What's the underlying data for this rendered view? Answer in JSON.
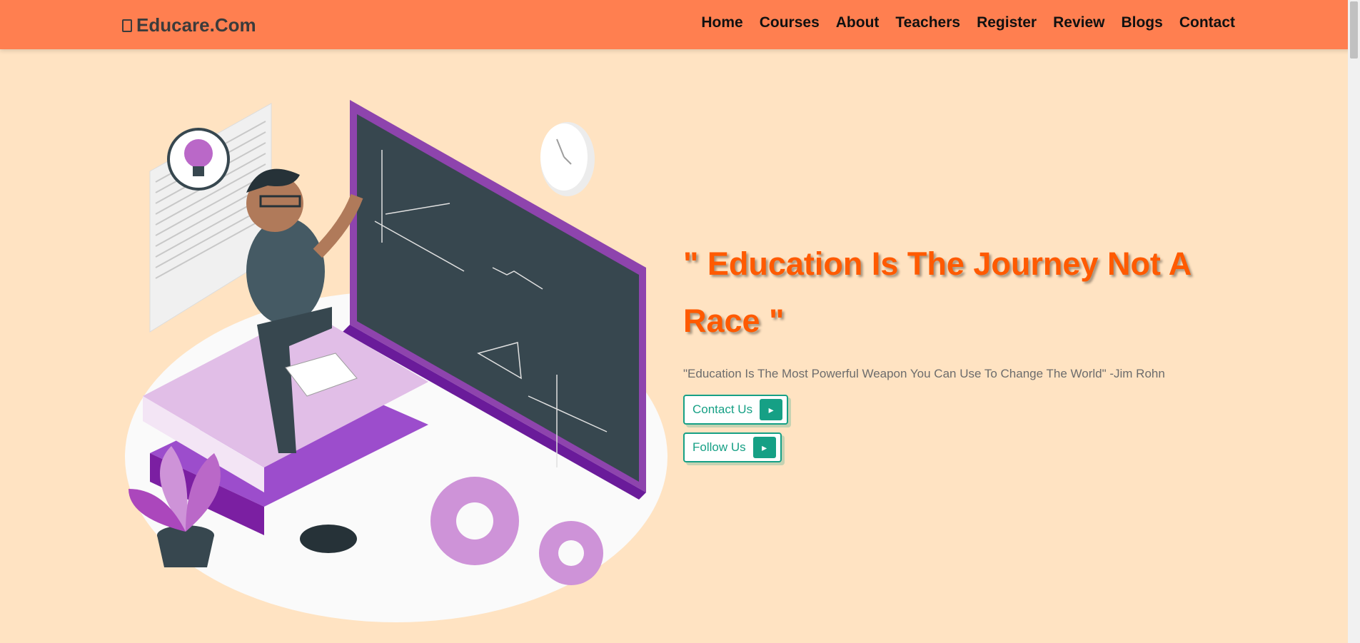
{
  "navbar": {
    "brand": "Educare.Com",
    "links": [
      "Home",
      "Courses",
      "About",
      "Teachers",
      "Register",
      "Review",
      "Blogs",
      "Contact"
    ]
  },
  "hero": {
    "headline_line1": "\" Education Is The Journey Not A",
    "headline_line2": "Race \"",
    "quote": "\"Education Is The Most Powerful Weapon You Can Use To Change The World\" -Jim Rohn",
    "buttons": [
      {
        "label": "Contact Us",
        "icon": "arrow-right-icon"
      },
      {
        "label": "Follow Us",
        "icon": "arrow-right-icon"
      }
    ]
  },
  "colors": {
    "navbar": "#ff7f50",
    "background": "#ffe3c2",
    "headline": "#ff5a00",
    "accent": "#16a085"
  }
}
